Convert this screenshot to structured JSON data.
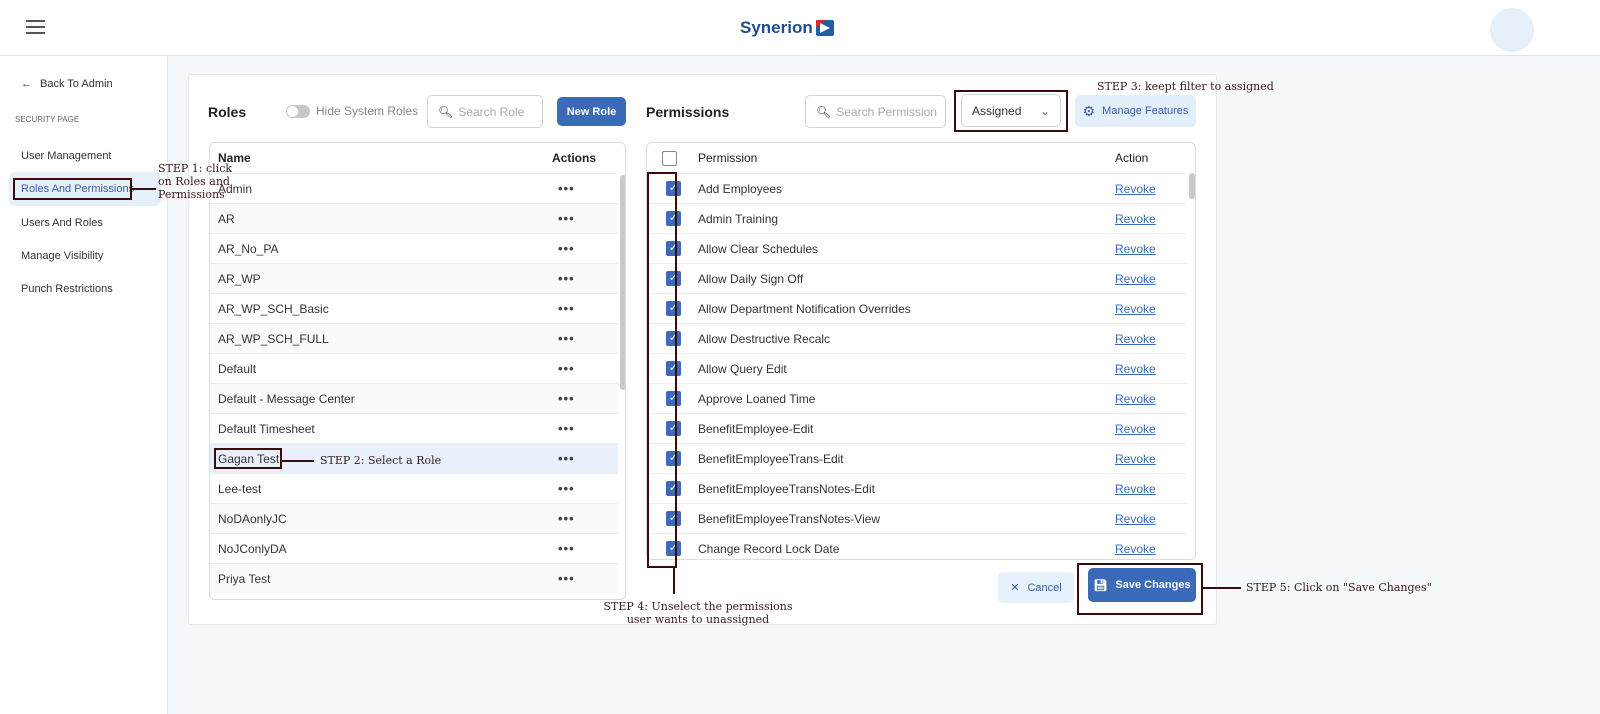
{
  "header": {
    "brand": "Synerion",
    "menu_icon": "hamburger-icon",
    "avatar": "avatar"
  },
  "sidebar": {
    "back": "Back To Admin",
    "section": "SECURITY PAGE",
    "items": [
      {
        "label": "User Management"
      },
      {
        "label": "Roles And Permissions",
        "active": true
      },
      {
        "label": "Users And Roles"
      },
      {
        "label": "Manage Visibility"
      },
      {
        "label": "Punch Restrictions"
      }
    ]
  },
  "roles": {
    "title": "Roles",
    "toggle_label": "Hide System Roles",
    "toggle_on": false,
    "search_placeholder": "Search Role",
    "new_button": "New Role",
    "col_name": "Name",
    "col_actions": "Actions",
    "actions_glyph": "•••",
    "selected": "Gagan Test",
    "items": [
      "Admin",
      "AR",
      "AR_No_PA",
      "AR_WP",
      "AR_WP_SCH_Basic",
      "AR_WP_SCH_FULL",
      "Default",
      "Default - Message Center",
      "Default Timesheet",
      "Gagan Test",
      "Lee-test",
      "NoDAonlyJC",
      "NoJConlyDA",
      "Priya Test"
    ]
  },
  "permissions": {
    "title": "Permissions",
    "search_placeholder": "Search Permission",
    "filter": "Assigned",
    "manage_button": "Manage Features",
    "col_permission": "Permission",
    "col_action": "Action",
    "revoke_label": "Revoke",
    "items": [
      "Add Employees",
      "Admin Training",
      "Allow Clear Schedules",
      "Allow Daily Sign Off",
      "Allow Department Notification Overrides",
      "Allow Destructive Recalc",
      "Allow Query Edit",
      "Approve Loaned Time",
      "BenefitEmployee-Edit",
      "BenefitEmployeeTrans-Edit",
      "BenefitEmployeeTransNotes-Edit",
      "BenefitEmployeeTransNotes-View",
      "Change Record Lock Date"
    ]
  },
  "footer": {
    "cancel": "Cancel",
    "save": "Save Changes"
  },
  "annotations": {
    "step1": "STEP 1: click on Roles and Permissions",
    "step2": "STEP 2: Select a Role",
    "step3": "STEP 3: keept filter to assigned",
    "step4": "STEP 4: Unselect the permissions user wants to unassigned",
    "step5": "STEP 5: Click on \"Save Changes\""
  },
  "colors": {
    "accent": "#3a6ab8",
    "annotation": "#3b0a0a",
    "selected_row": "#e8f1fb"
  }
}
